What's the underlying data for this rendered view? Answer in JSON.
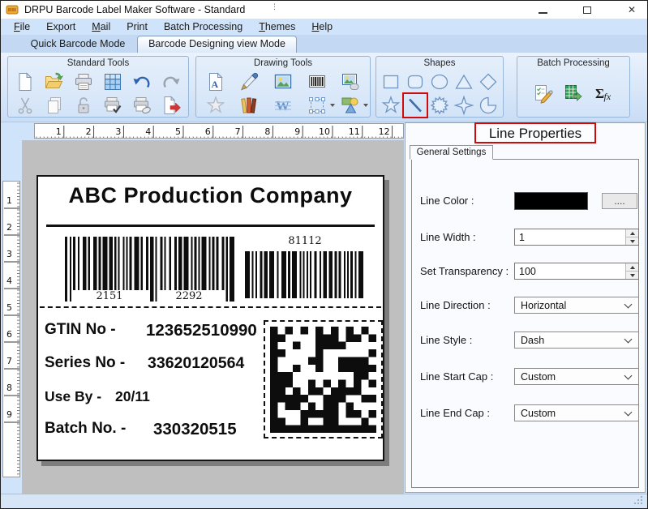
{
  "window": {
    "title": "DRPU Barcode Label Maker Software - Standard"
  },
  "titlebar": {
    "controls": [
      "minimize",
      "maximize",
      "close"
    ]
  },
  "menu": {
    "items": [
      {
        "label": "File",
        "underline_first": true
      },
      {
        "label": "Export",
        "underline_first": false
      },
      {
        "label": "Mail",
        "underline_first": true
      },
      {
        "label": "Print",
        "underline_first": false
      },
      {
        "label": "Batch Processing",
        "underline_first": false
      },
      {
        "label": "Themes",
        "underline_first": true
      },
      {
        "label": "Help",
        "underline_first": true
      }
    ]
  },
  "mode_tabs": [
    {
      "label": "Quick Barcode Mode",
      "active": false
    },
    {
      "label": "Barcode Designing view Mode",
      "active": true
    }
  ],
  "toolbar": {
    "groups": [
      {
        "title": "Standard Tools",
        "rows": [
          [
            {
              "icon": "new-document"
            },
            {
              "icon": "open-folder"
            },
            {
              "icon": "printer"
            },
            {
              "icon": "grid"
            },
            {
              "icon": "undo"
            },
            {
              "icon": "redo"
            }
          ],
          [
            {
              "icon": "cut",
              "disabled": true
            },
            {
              "icon": "copy",
              "disabled": true
            },
            {
              "icon": "lock",
              "disabled": true
            },
            {
              "icon": "printer-check"
            },
            {
              "icon": "printer-edit"
            },
            {
              "icon": "export-page"
            }
          ]
        ]
      },
      {
        "title": "Drawing Tools",
        "rows": [
          [
            {
              "icon": "text-page"
            },
            {
              "icon": "pen"
            },
            {
              "icon": "image"
            },
            {
              "icon": "barcode"
            },
            {
              "icon": "image-shape"
            }
          ],
          [
            {
              "icon": "star-outline",
              "disabled": true
            },
            {
              "icon": "books"
            },
            {
              "icon": "watermark"
            },
            {
              "icon": "frame-select",
              "dropdown": true
            },
            {
              "icon": "shapes-picker",
              "dropdown": true
            }
          ]
        ]
      },
      {
        "title": "Shapes",
        "rows": [
          [
            {
              "icon": "shape-rectangle"
            },
            {
              "icon": "shape-rounded-rect"
            },
            {
              "icon": "shape-ellipse"
            },
            {
              "icon": "shape-triangle"
            },
            {
              "icon": "shape-diamond"
            }
          ],
          [
            {
              "icon": "shape-star"
            },
            {
              "icon": "shape-line",
              "highlighted": true
            },
            {
              "icon": "shape-starburst"
            },
            {
              "icon": "shape-star4"
            },
            {
              "icon": "shape-pie"
            }
          ]
        ]
      },
      {
        "title": "Batch Processing",
        "rows": [
          [
            {
              "icon": "list-edit"
            },
            {
              "icon": "excel-import"
            },
            {
              "icon": "sigma-fx"
            }
          ]
        ]
      }
    ]
  },
  "rulers": {
    "horizontal_ticks": [
      1,
      2,
      3,
      4,
      5,
      6,
      7,
      8,
      9,
      10,
      11,
      12
    ],
    "vertical_ticks": [
      1,
      2,
      3,
      4,
      5,
      6,
      7,
      8,
      9
    ]
  },
  "label_design": {
    "company_name": "ABC Production Company",
    "barcode_main": {
      "left_number": "2151",
      "right_number": "2292"
    },
    "barcode_secondary": {
      "top_number": "81112"
    },
    "fields": [
      {
        "label": "GTIN No -",
        "value": "123652510990"
      },
      {
        "label": "Series No -",
        "value": "33620120564"
      },
      {
        "label": "Use By -",
        "value": "20/11"
      },
      {
        "label": "Batch No. -",
        "value": "330320515"
      }
    ]
  },
  "properties_panel": {
    "title": "Line Properties",
    "tab_label": "General Settings",
    "line_color": {
      "label": "Line Color :",
      "value": "#000000",
      "button_label": "...."
    },
    "line_width": {
      "label": "Line Width :",
      "value": "1"
    },
    "transparency": {
      "label": "Set Transparency :",
      "value": "100"
    },
    "line_direction": {
      "label": "Line Direction :",
      "value": "Horizontal"
    },
    "line_style": {
      "label": "Line Style :",
      "value": "Dash"
    },
    "line_start_cap": {
      "label": "Line Start Cap :",
      "value": "Custom"
    },
    "line_end_cap": {
      "label": "Line End Cap :",
      "value": "Custom"
    }
  },
  "colors": {
    "highlight_red": "#cf0a0a",
    "line_color_swatch": "#000000",
    "canvas_bg": "#bfbfbf",
    "chrome_blue": "#cfe3fa"
  }
}
